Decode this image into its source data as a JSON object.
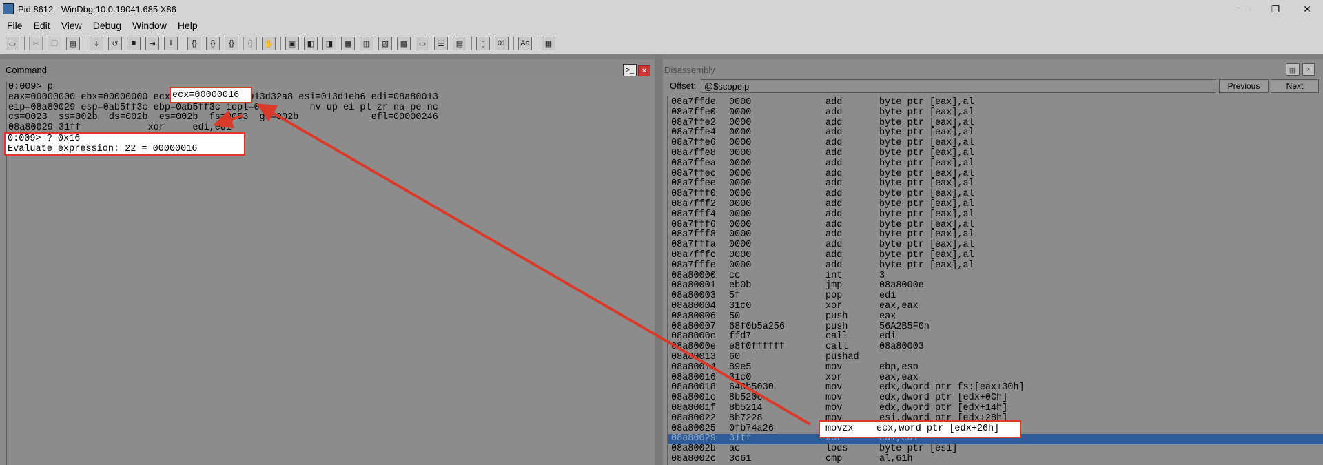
{
  "window": {
    "title": "Pid 8612 - WinDbg:10.0.19041.685 X86",
    "controls": [
      "—",
      "❐",
      "✕"
    ]
  },
  "menu": [
    "File",
    "Edit",
    "View",
    "Debug",
    "Window",
    "Help"
  ],
  "command_panel": {
    "title": "Command",
    "lines": [
      "0:009> p",
      "eax=00000000 ebx=00000000 ecx=00000016 edx=013d32a8 esi=013d1eb6 edi=08a80013",
      "eip=08a80029 esp=0ab5ff3c ebp=0ab5ff3c iopl=0         nv up ei pl zr na pe nc",
      "cs=0023  ss=002b  ds=002b  es=002b  fs=0053  gs=002b             efl=00000246",
      "08a80029 31ff            xor     edi,edi",
      "0:009> ? 0x16",
      "Evaluate expression: 22 = 00000016"
    ],
    "highlight_ecx": "ecx=00000016"
  },
  "disassembly_panel": {
    "title": "Disassembly",
    "offset_label": "Offset:",
    "offset_value": "@$scopeip",
    "previous_label": "Previous",
    "next_label": "Next",
    "rows": [
      [
        "08a7ffde",
        "0000",
        "add",
        "byte ptr [eax],al"
      ],
      [
        "08a7ffe0",
        "0000",
        "add",
        "byte ptr [eax],al"
      ],
      [
        "08a7ffe2",
        "0000",
        "add",
        "byte ptr [eax],al"
      ],
      [
        "08a7ffe4",
        "0000",
        "add",
        "byte ptr [eax],al"
      ],
      [
        "08a7ffe6",
        "0000",
        "add",
        "byte ptr [eax],al"
      ],
      [
        "08a7ffe8",
        "0000",
        "add",
        "byte ptr [eax],al"
      ],
      [
        "08a7ffea",
        "0000",
        "add",
        "byte ptr [eax],al"
      ],
      [
        "08a7ffec",
        "0000",
        "add",
        "byte ptr [eax],al"
      ],
      [
        "08a7ffee",
        "0000",
        "add",
        "byte ptr [eax],al"
      ],
      [
        "08a7fff0",
        "0000",
        "add",
        "byte ptr [eax],al"
      ],
      [
        "08a7fff2",
        "0000",
        "add",
        "byte ptr [eax],al"
      ],
      [
        "08a7fff4",
        "0000",
        "add",
        "byte ptr [eax],al"
      ],
      [
        "08a7fff6",
        "0000",
        "add",
        "byte ptr [eax],al"
      ],
      [
        "08a7fff8",
        "0000",
        "add",
        "byte ptr [eax],al"
      ],
      [
        "08a7fffa",
        "0000",
        "add",
        "byte ptr [eax],al"
      ],
      [
        "08a7fffc",
        "0000",
        "add",
        "byte ptr [eax],al"
      ],
      [
        "08a7fffe",
        "0000",
        "add",
        "byte ptr [eax],al"
      ],
      [
        "08a80000",
        "cc",
        "int",
        "3"
      ],
      [
        "08a80001",
        "eb0b",
        "jmp",
        "08a8000e"
      ],
      [
        "08a80003",
        "5f",
        "pop",
        "edi"
      ],
      [
        "08a80004",
        "31c0",
        "xor",
        "eax,eax"
      ],
      [
        "08a80006",
        "50",
        "push",
        "eax"
      ],
      [
        "08a80007",
        "68f0b5a256",
        "push",
        "56A2B5F0h"
      ],
      [
        "08a8000c",
        "ffd7",
        "call",
        "edi"
      ],
      [
        "08a8000e",
        "e8f0ffffff",
        "call",
        "08a80003"
      ],
      [
        "08a80013",
        "60",
        "pushad",
        ""
      ],
      [
        "08a80014",
        "89e5",
        "mov",
        "ebp,esp"
      ],
      [
        "08a80016",
        "31c0",
        "xor",
        "eax,eax"
      ],
      [
        "08a80018",
        "648b5030",
        "mov",
        "edx,dword ptr fs:[eax+30h]"
      ],
      [
        "08a8001c",
        "8b520c",
        "mov",
        "edx,dword ptr [edx+0Ch]"
      ],
      [
        "08a8001f",
        "8b5214",
        "mov",
        "edx,dword ptr [edx+14h]"
      ],
      [
        "08a80022",
        "8b7228",
        "mov",
        "esi,dword ptr [edx+28h]"
      ],
      [
        "08a80025",
        "0fb74a26",
        "movzx",
        "ecx,word ptr [edx+26h]"
      ],
      [
        "08a80029",
        "31ff",
        "xor",
        "edi,edi"
      ],
      [
        "08a8002b",
        "ac",
        "lods",
        "byte ptr [esi]"
      ],
      [
        "08a8002c",
        "3c61",
        "cmp",
        "al,61h"
      ]
    ],
    "selected_index": 33,
    "highlight_index": 32
  },
  "annotation": {
    "color": "#d93a2a"
  }
}
